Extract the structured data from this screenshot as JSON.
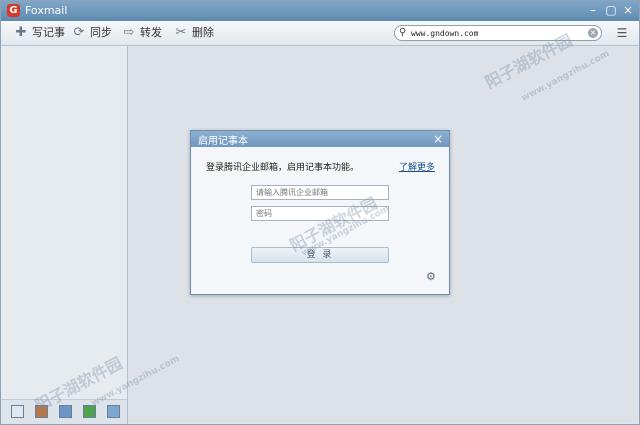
{
  "window": {
    "title": "Foxmail"
  },
  "toolbar": {
    "write_note": "写记事",
    "sync": "同步",
    "forward": "转发",
    "delete": "删除"
  },
  "search": {
    "value": "www.gndown.com"
  },
  "dialog": {
    "title": "启用记事本",
    "description": "登录腾讯企业邮箱，启用记事本功能。",
    "learn_more": "了解更多",
    "email_placeholder": "请输入腾讯企业邮箱",
    "password_placeholder": "密码",
    "login_label": "登 录"
  },
  "watermarks": [
    {
      "text": "阳子湖软件园",
      "sub": "www.yangzihu.com"
    }
  ],
  "icons": [
    "close-icon",
    "minimize-icon",
    "search-icon",
    "settings-icon",
    "menu-icon"
  ],
  "colors": {
    "titlebar": "#6b94b9",
    "accent": "#1a4f8a"
  }
}
